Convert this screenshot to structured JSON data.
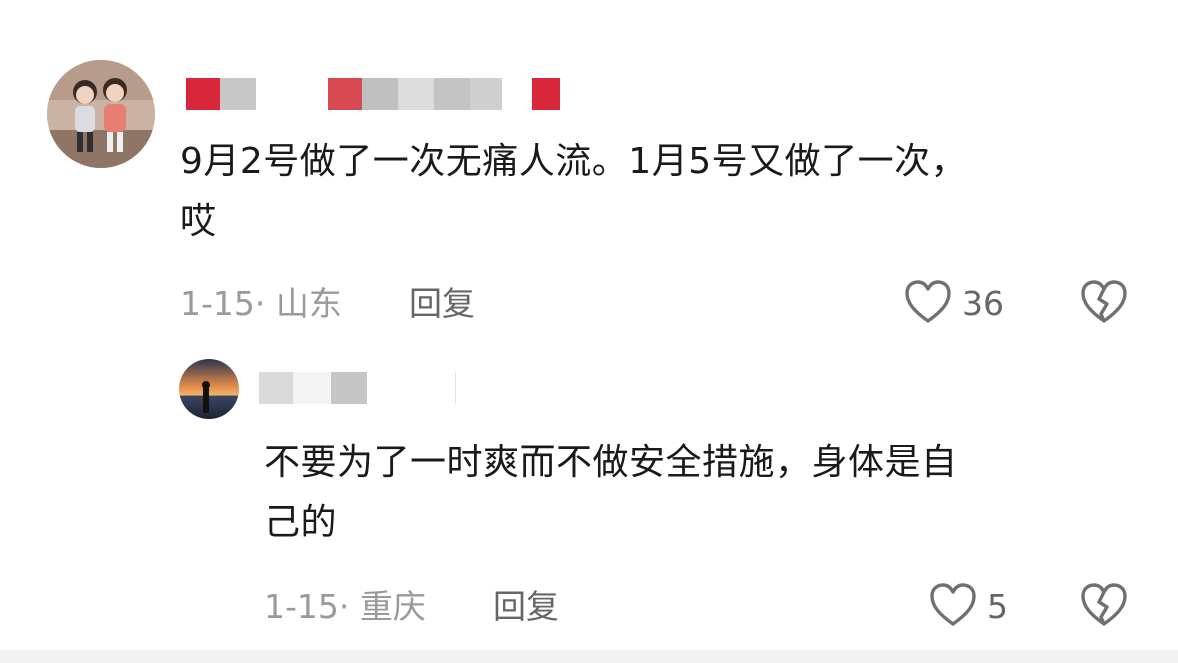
{
  "main_comment": {
    "text_line1": "9月2号做了一次无痛人流。1月5号又做了一次，",
    "text_line2": "哎",
    "date_location": "1-15· 山东",
    "reply_label": "回复",
    "likes": "36"
  },
  "reply_comment": {
    "text_line1": "不要为了一时爽而不做安全措施，身体是自",
    "text_line2": "己的",
    "date_location": "1-15· 重庆",
    "reply_label": "回复",
    "likes": "5"
  },
  "colors": {
    "text": "#1a1a1a",
    "meta": "#9a9a9a",
    "secondary": "#666666",
    "mask_red": "#d8263a",
    "mask_gray": "#c8c8c8"
  },
  "icons": {
    "like": "heart-outline-icon",
    "dislike": "broken-heart-icon"
  }
}
